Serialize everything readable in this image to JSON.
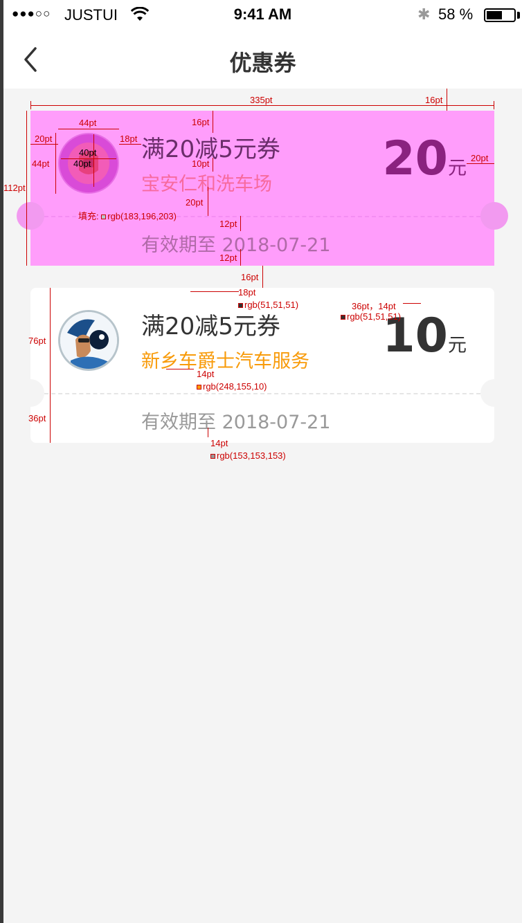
{
  "status_bar": {
    "signal": "●●●○○",
    "carrier": "JUSTUI",
    "time": "9:41 AM",
    "bluetooth": "✱",
    "battery_pct": "58 %",
    "battery_level": 0.58
  },
  "nav": {
    "title": "优惠券"
  },
  "coupons": [
    {
      "title": "满20减5元券",
      "shop": "宝安仁和洗车场",
      "amount": "20",
      "unit": "元",
      "expiry": "有效期至 2018-07-21"
    },
    {
      "title": "满20减5元券",
      "shop": "新乡车爵士汽车服务",
      "amount": "10",
      "unit": "元",
      "expiry": "有效期至 2018-07-21"
    }
  ],
  "annotations": {
    "width_335": "335pt",
    "gap_16_top": "16pt",
    "left_20": "20pt",
    "logo_44w": "44pt",
    "logo_44h": "44pt",
    "text_18": "18pt",
    "icon_40a": "40pt",
    "icon_40b": "40pt",
    "title_top_16": "16pt",
    "line_gap_10": "10pt",
    "bottom_20": "20pt",
    "right_20": "20pt",
    "height_112": "112pt",
    "fill_label": "填充: ",
    "fill_color": "rgb(183,196,203)",
    "dash_12a": "12pt",
    "dash_12b": "12pt",
    "gap_16_mid": "16pt",
    "font_18": "18pt",
    "color_title": "rgb(51,51,51)",
    "amount_font": "36pt，14pt",
    "color_amount": "rgb(51,51,51)",
    "height_76": "76pt",
    "height_36": "36pt",
    "shop_font": "14pt",
    "color_shop": "rgb(248,155,10)",
    "expiry_font": "14pt",
    "color_expiry": "rgb(153,153,153)",
    "colors": {
      "title": "#333333",
      "shop": "#f89b0a",
      "expiry": "#999999",
      "fill": "#b7c4cb"
    }
  }
}
